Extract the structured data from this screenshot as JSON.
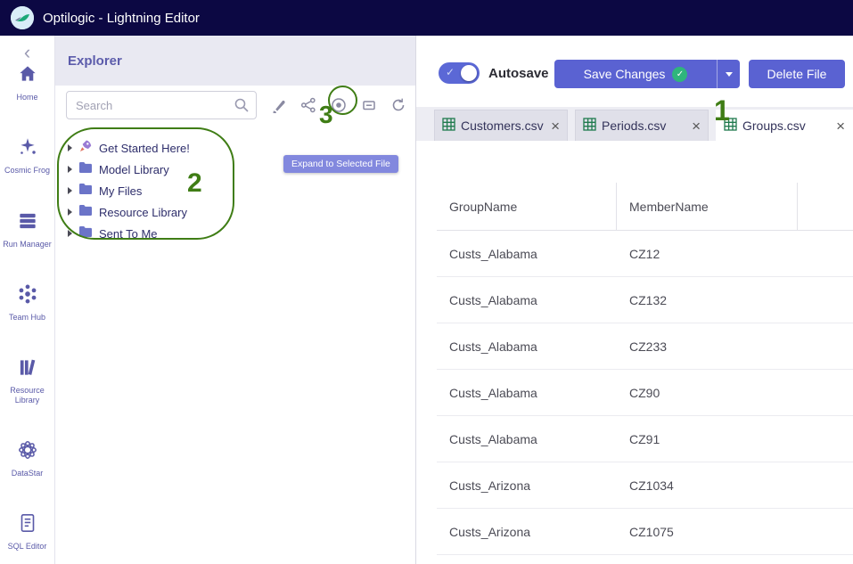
{
  "titlebar": {
    "title": "Optilogic - Lightning Editor"
  },
  "rail": {
    "items": [
      {
        "label": "Home"
      },
      {
        "label": "Cosmic Frog"
      },
      {
        "label": "Run Manager"
      },
      {
        "label": "Team Hub"
      },
      {
        "label": "Resource Library"
      },
      {
        "label": "DataStar"
      },
      {
        "label": "SQL Editor"
      }
    ]
  },
  "explorer": {
    "title": "Explorer",
    "search_placeholder": "Search",
    "tooltip": "Expand to Selected File",
    "tree": [
      {
        "label": "Get Started Here!"
      },
      {
        "label": "Model Library"
      },
      {
        "label": "My Files"
      },
      {
        "label": "Resource Library"
      },
      {
        "label": "Sent To Me"
      }
    ]
  },
  "toolbar": {
    "autosave": "Autosave",
    "save": "Save Changes",
    "delete": "Delete File"
  },
  "tabs": {
    "items": [
      {
        "label": "Customers.csv"
      },
      {
        "label": "Periods.csv"
      },
      {
        "label": "Groups.csv"
      }
    ]
  },
  "table": {
    "columns": [
      "GroupName",
      "MemberName"
    ],
    "rows": [
      [
        "Custs_Alabama",
        "CZ12"
      ],
      [
        "Custs_Alabama",
        "CZ132"
      ],
      [
        "Custs_Alabama",
        "CZ233"
      ],
      [
        "Custs_Alabama",
        "CZ90"
      ],
      [
        "Custs_Alabama",
        "CZ91"
      ],
      [
        "Custs_Arizona",
        "CZ1034"
      ],
      [
        "Custs_Arizona",
        "CZ1075"
      ]
    ]
  },
  "annotations": {
    "one": "1",
    "two": "2",
    "three": "3"
  },
  "icons": {
    "close": "×",
    "check": "✓",
    "back": "‹"
  },
  "colors": {
    "accent": "#5a62d2",
    "topbar": "#0c0843",
    "annotation_green": "#3f7d15",
    "badge_green": "#2fb57c"
  }
}
